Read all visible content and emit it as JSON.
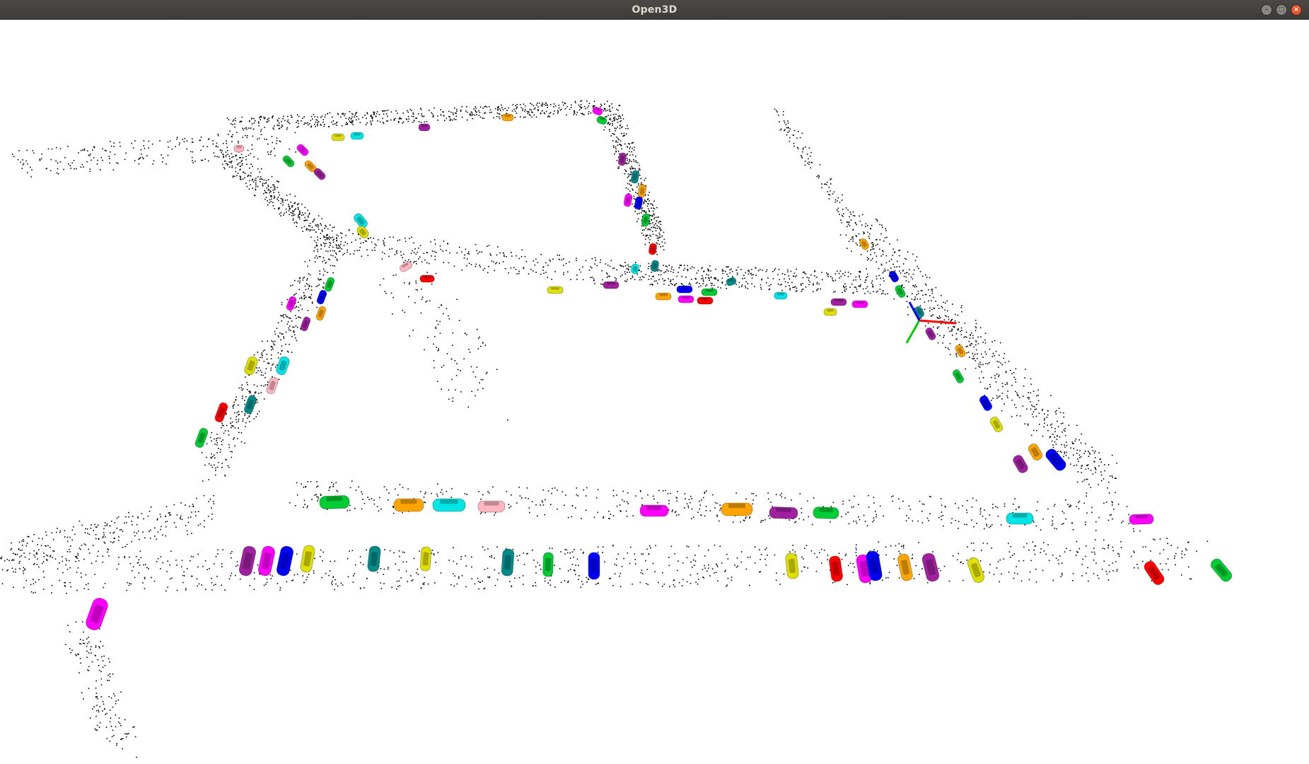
{
  "window": {
    "title": "Open3D",
    "buttons": {
      "minimize_glyph": "–",
      "maximize_glyph": "□",
      "close_glyph": "×"
    }
  },
  "scene": {
    "background": "#ffffff",
    "point_color": "#000000",
    "axis_colors": {
      "x": "#ff0000",
      "y": "#00cc00",
      "z": "#0000ff"
    },
    "car_palette": [
      "#ff00ff",
      "#ffa500",
      "#00e5e5",
      "#00cc33",
      "#a020a0",
      "#0000ff",
      "#e0e000",
      "#008b8b",
      "#ff0000",
      "#ffb6c1"
    ]
  }
}
